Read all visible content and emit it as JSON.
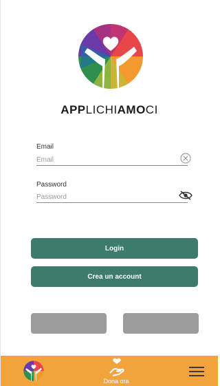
{
  "brand": {
    "name_part1": "APP",
    "name_part2": "LICHI",
    "name_part3": "AMO",
    "name_part4": "CI"
  },
  "login_form": {
    "email_label": "Email",
    "email_placeholder": "Email",
    "email_value": "",
    "clear_icon": "clear-circle-x-icon",
    "password_label": "Password",
    "password_placeholder": "Password",
    "password_value": "",
    "visibility_icon": "eye-slash-icon"
  },
  "actions": {
    "login_label": "Login",
    "create_account_label": "Crea un account",
    "secondary_left_label": "",
    "secondary_right_label": ""
  },
  "bottom_nav": {
    "home_icon": "app-logo-icon",
    "donate_icon": "hand-heart-icon",
    "donate_label": "Dona ora",
    "menu_icon": "hamburger-menu-icon"
  },
  "colors": {
    "primary_button": "#3d7c6d",
    "bottom_bar": "#f2a43c",
    "secondary_button": "#9c9c9c",
    "text": "#1b1b1b"
  }
}
